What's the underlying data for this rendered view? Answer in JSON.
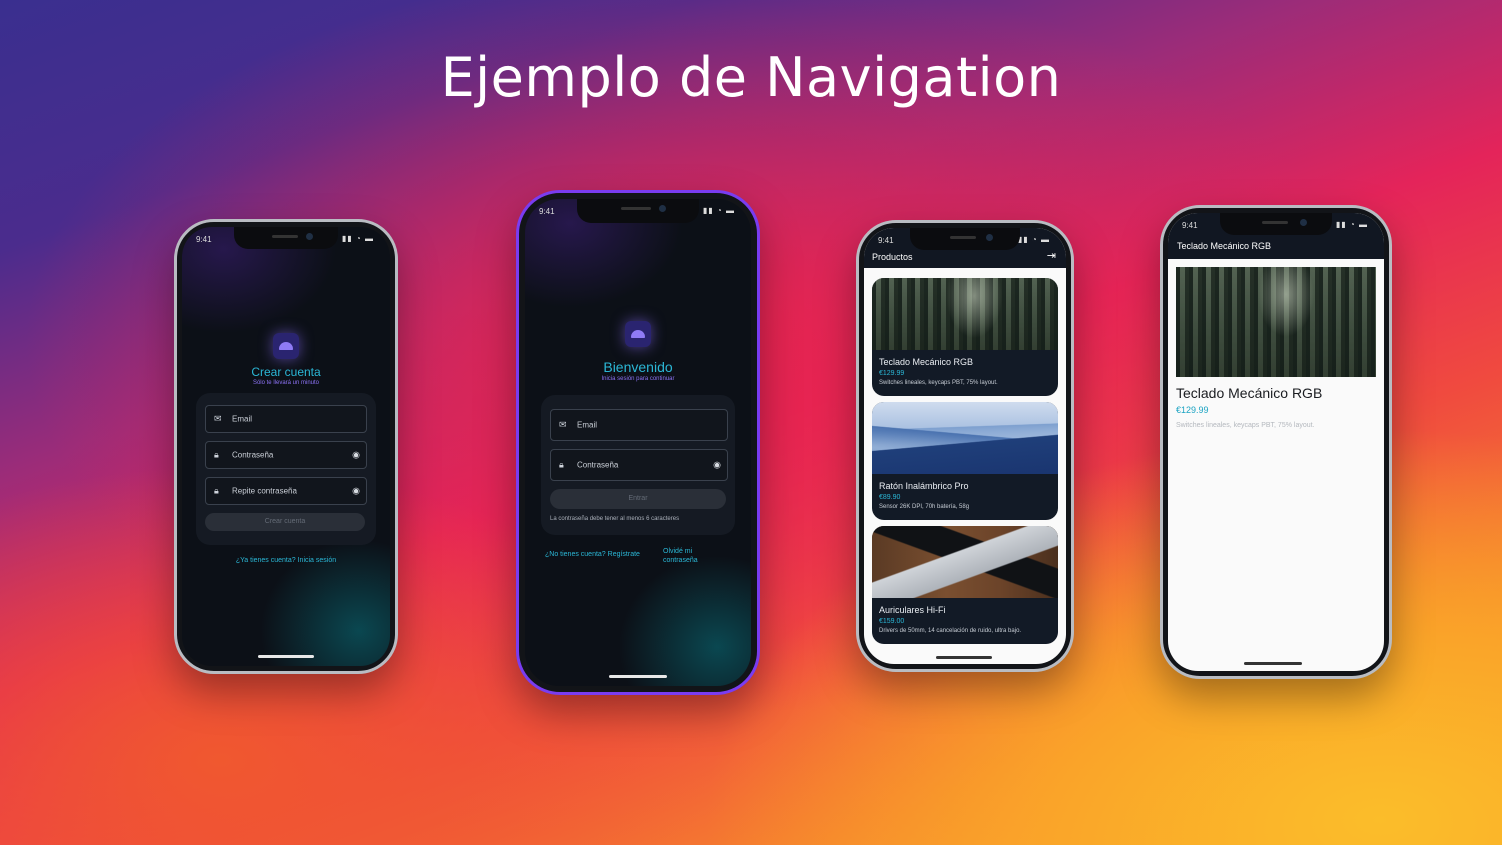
{
  "headline": "Ejemplo de Navigation",
  "status_time": "9:41",
  "status_icons": "▮▮ ◔ ▬",
  "register": {
    "title": "Crear cuenta",
    "subtitle": "Sólo te llevará un minuto",
    "email": "Email",
    "password": "Contraseña",
    "repeat_password": "Repite contraseña",
    "button": "Crear cuenta",
    "login_link": "¿Ya tienes cuenta? Inicia sesión"
  },
  "login": {
    "title": "Bienvenido",
    "subtitle": "Inicia sesión para continuar",
    "email": "Email",
    "password": "Contraseña",
    "button": "Entrar",
    "hint": "La contraseña debe tener al menos 6 caracteres",
    "register_link": "¿No tienes cuenta? Regístrate",
    "forgot_link": "Olvidé mi contraseña"
  },
  "products": {
    "appbar_title": "Productos",
    "logout_icon": "⇥",
    "items": [
      {
        "name": "Teclado Mecánico RGB",
        "price": "€129.99",
        "desc": "Switches lineales, keycaps PBT, 75% layout."
      },
      {
        "name": "Ratón Inalámbrico Pro",
        "price": "€89.90",
        "desc": "Sensor 26K DPI, 70h batería, 58g"
      },
      {
        "name": "Auriculares Hi-Fi",
        "price": "€159.00",
        "desc": "Drivers de 50mm, 14 cancelación de ruido, ultra bajo."
      }
    ]
  },
  "detail": {
    "appbar_title": "Teclado Mecánico RGB",
    "name": "Teclado Mecánico RGB",
    "price": "€129.99",
    "desc": "Switches lineales, keycaps PBT, 75% layout."
  },
  "colors": {
    "accent_cyan": "#2bb7d6",
    "accent_purple": "#8c72f4"
  }
}
